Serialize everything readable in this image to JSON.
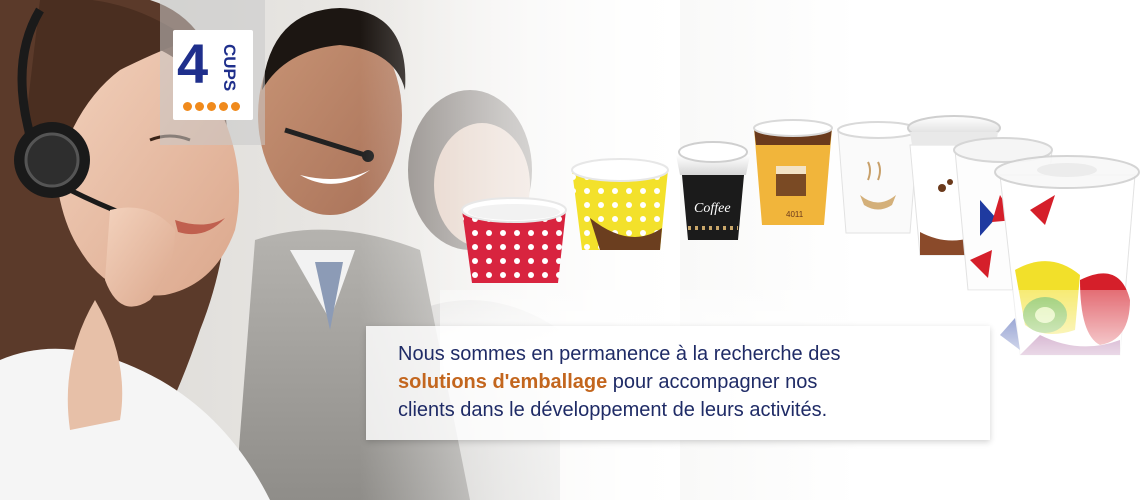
{
  "logo": {
    "number": "4",
    "word": "CUPS",
    "alt": "4 CUPS logo"
  },
  "message": {
    "line1": "Nous sommes en permanence à la recherche des",
    "highlight": "solutions d'emballage",
    "line2_rest": " pour accompagner nos",
    "line3": "clients dans le développement de leurs activités."
  },
  "cup_print": {
    "coffee_label": "Coffee",
    "code_label": "4011"
  },
  "colors": {
    "brand_blue": "#1f2f8c",
    "brand_orange": "#f08a1c",
    "text_blue": "#1f2b66",
    "highlight_orange": "#c3661e"
  }
}
